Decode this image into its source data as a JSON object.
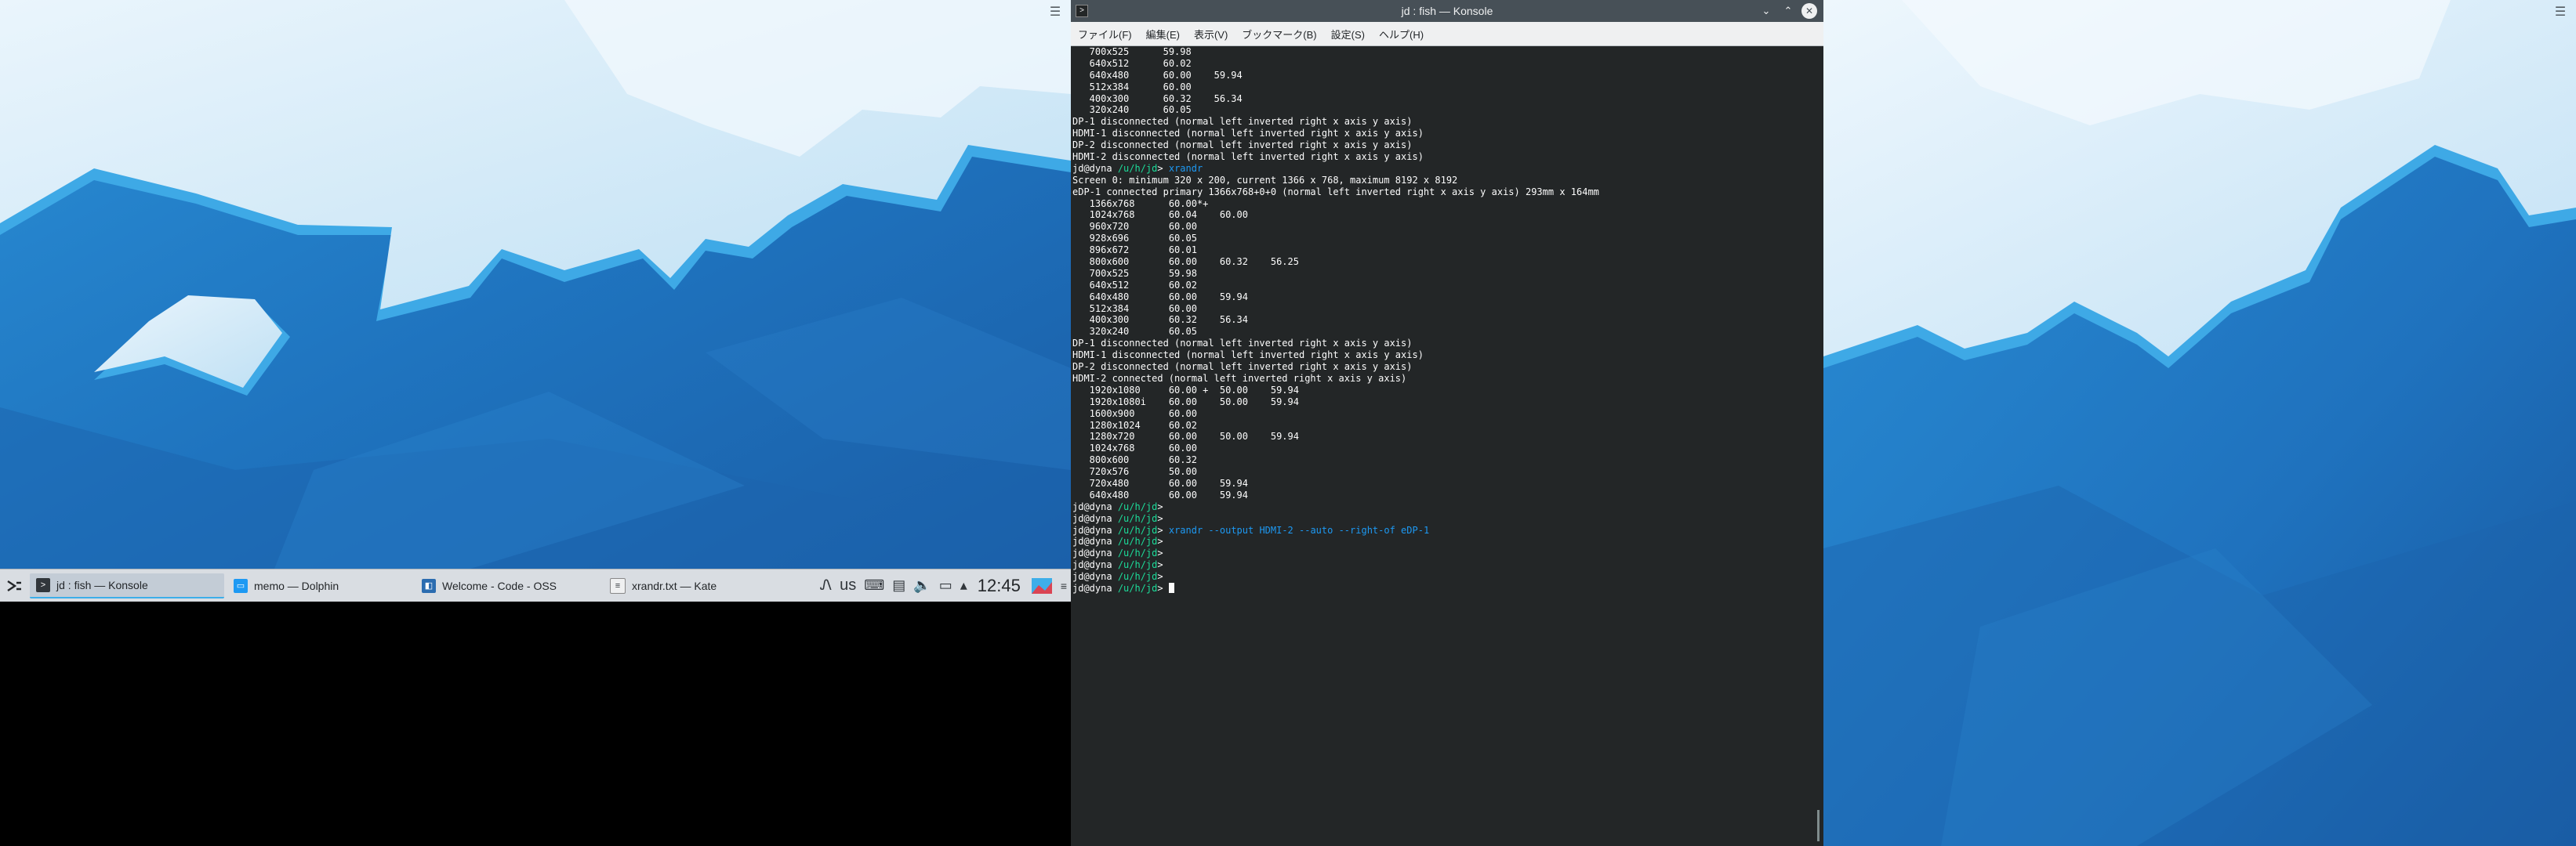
{
  "taskbar": {
    "tasks": [
      {
        "label": "jd : fish — Konsole",
        "icon": "konsole-icon",
        "active": true
      },
      {
        "label": "memo — Dolphin",
        "icon": "dolphin-icon",
        "active": false
      },
      {
        "label": "Welcome - Code - OSS",
        "icon": "code-oss-icon",
        "active": false
      },
      {
        "label": "xrandr.txt — Kate",
        "icon": "kate-icon",
        "active": false
      }
    ],
    "keyboard_layout": "us",
    "clock": "12:45"
  },
  "konsole": {
    "title": "jd : fish — Konsole",
    "menu": [
      "ファイル(F)",
      "編集(E)",
      "表示(V)",
      "ブックマーク(B)",
      "設定(S)",
      "ヘルプ(H)"
    ],
    "terminal": [
      {
        "type": "text",
        "text": "   700x525      59.98"
      },
      {
        "type": "text",
        "text": "   640x512      60.02"
      },
      {
        "type": "text",
        "text": "   640x480      60.00    59.94"
      },
      {
        "type": "text",
        "text": "   512x384      60.00"
      },
      {
        "type": "text",
        "text": "   400x300      60.32    56.34"
      },
      {
        "type": "text",
        "text": "   320x240      60.05"
      },
      {
        "type": "text",
        "text": "DP-1 disconnected (normal left inverted right x axis y axis)"
      },
      {
        "type": "text",
        "text": "HDMI-1 disconnected (normal left inverted right x axis y axis)"
      },
      {
        "type": "text",
        "text": "DP-2 disconnected (normal left inverted right x axis y axis)"
      },
      {
        "type": "text",
        "text": "HDMI-2 disconnected (normal left inverted right x axis y axis)"
      },
      {
        "type": "prompt",
        "user": "jd@dyna",
        "path": "/u/h/jd",
        "cmd": "xrandr"
      },
      {
        "type": "text",
        "text": "Screen 0: minimum 320 x 200, current 1366 x 768, maximum 8192 x 8192"
      },
      {
        "type": "text",
        "text": "eDP-1 connected primary 1366x768+0+0 (normal left inverted right x axis y axis) 293mm x 164mm"
      },
      {
        "type": "text",
        "text": "   1366x768      60.00*+"
      },
      {
        "type": "text",
        "text": "   1024x768      60.04    60.00"
      },
      {
        "type": "text",
        "text": "   960x720       60.00"
      },
      {
        "type": "text",
        "text": "   928x696       60.05"
      },
      {
        "type": "text",
        "text": "   896x672       60.01"
      },
      {
        "type": "text",
        "text": "   800x600       60.00    60.32    56.25"
      },
      {
        "type": "text",
        "text": "   700x525       59.98"
      },
      {
        "type": "text",
        "text": "   640x512       60.02"
      },
      {
        "type": "text",
        "text": "   640x480       60.00    59.94"
      },
      {
        "type": "text",
        "text": "   512x384       60.00"
      },
      {
        "type": "text",
        "text": "   400x300       60.32    56.34"
      },
      {
        "type": "text",
        "text": "   320x240       60.05"
      },
      {
        "type": "text",
        "text": "DP-1 disconnected (normal left inverted right x axis y axis)"
      },
      {
        "type": "text",
        "text": "HDMI-1 disconnected (normal left inverted right x axis y axis)"
      },
      {
        "type": "text",
        "text": "DP-2 disconnected (normal left inverted right x axis y axis)"
      },
      {
        "type": "text",
        "text": "HDMI-2 connected (normal left inverted right x axis y axis)"
      },
      {
        "type": "text",
        "text": "   1920x1080     60.00 +  50.00    59.94"
      },
      {
        "type": "text",
        "text": "   1920x1080i    60.00    50.00    59.94"
      },
      {
        "type": "text",
        "text": "   1600x900      60.00"
      },
      {
        "type": "text",
        "text": "   1280x1024     60.02"
      },
      {
        "type": "text",
        "text": "   1280x720      60.00    50.00    59.94"
      },
      {
        "type": "text",
        "text": "   1024x768      60.00"
      },
      {
        "type": "text",
        "text": "   800x600       60.32"
      },
      {
        "type": "text",
        "text": "   720x576       50.00"
      },
      {
        "type": "text",
        "text": "   720x480       60.00    59.94"
      },
      {
        "type": "text",
        "text": "   640x480       60.00    59.94"
      },
      {
        "type": "prompt",
        "user": "jd@dyna",
        "path": "/u/h/jd",
        "cmd": ""
      },
      {
        "type": "prompt",
        "user": "jd@dyna",
        "path": "/u/h/jd",
        "cmd": ""
      },
      {
        "type": "prompt",
        "user": "jd@dyna",
        "path": "/u/h/jd",
        "cmd": "xrandr --output HDMI-2 --auto --right-of eDP-1"
      },
      {
        "type": "prompt",
        "user": "jd@dyna",
        "path": "/u/h/jd",
        "cmd": ""
      },
      {
        "type": "prompt",
        "user": "jd@dyna",
        "path": "/u/h/jd",
        "cmd": ""
      },
      {
        "type": "prompt",
        "user": "jd@dyna",
        "path": "/u/h/jd",
        "cmd": ""
      },
      {
        "type": "prompt",
        "user": "jd@dyna",
        "path": "/u/h/jd",
        "cmd": ""
      },
      {
        "type": "prompt",
        "user": "jd@dyna",
        "path": "/u/h/jd",
        "cmd": "",
        "cursor": true
      }
    ]
  },
  "colors": {
    "terminal_bg": "#232627",
    "prompt_path": "#1cdc9a",
    "command": "#1d99f3",
    "accent": "#3daee9"
  }
}
